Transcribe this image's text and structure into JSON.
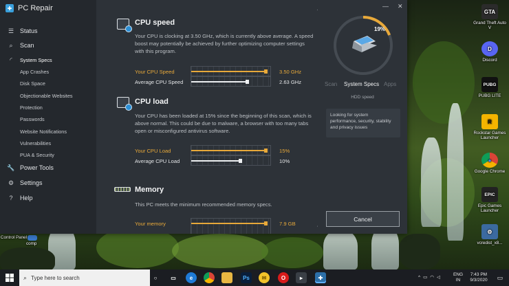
{
  "app": {
    "title": "PC Repair"
  },
  "sidebar": {
    "items": [
      {
        "label": "Status",
        "icon": "list-icon",
        "size": "big"
      },
      {
        "label": "Scan",
        "icon": "search-icon",
        "size": "big"
      },
      {
        "label": "System Specs",
        "icon": "spinner-icon",
        "size": "small",
        "active": true
      },
      {
        "label": "App Crashes",
        "icon": "none",
        "size": "small"
      },
      {
        "label": "Disk Space",
        "icon": "none",
        "size": "small"
      },
      {
        "label": "Objectionable Websites",
        "icon": "none",
        "size": "small"
      },
      {
        "label": "Protection",
        "icon": "none",
        "size": "small"
      },
      {
        "label": "Passwords",
        "icon": "none",
        "size": "small"
      },
      {
        "label": "Website Notifications",
        "icon": "none",
        "size": "small"
      },
      {
        "label": "Vulnerabilities",
        "icon": "none",
        "size": "small"
      },
      {
        "label": "PUA & Security",
        "icon": "none",
        "size": "small"
      },
      {
        "label": "Power Tools",
        "icon": "wrench-icon",
        "size": "big"
      },
      {
        "label": "Settings",
        "icon": "gear-icon",
        "size": "big"
      },
      {
        "label": "Help",
        "icon": "help-icon",
        "size": "big"
      }
    ]
  },
  "sections": {
    "cpu_speed": {
      "title": "CPU speed",
      "description": "Your CPU is clocking at 3.50 GHz, which is currently above average. A speed boost may potentially be achieved by further optimizing computer settings with this program.",
      "rows": [
        {
          "label": "Your CPU Speed",
          "value": "3.50 GHz",
          "fill": 0.95
        },
        {
          "label": "Average CPU Speed",
          "value": "2.63 GHz",
          "fill": 0.71
        }
      ]
    },
    "cpu_load": {
      "title": "CPU load",
      "description": "Your CPU has been loaded at 15% since the beginning of this scan, which is above normal. This could be due to malware, a browser with too many tabs open or misconfigured antivirus software.",
      "rows": [
        {
          "label": "Your CPU Load",
          "value": "15%",
          "fill": 0.95
        },
        {
          "label": "Average CPU Load",
          "value": "10%",
          "fill": 0.63
        }
      ]
    },
    "memory": {
      "title": "Memory",
      "description": "This PC meets the minimum recommended memory specs.",
      "rows": [
        {
          "label": "Your memory",
          "value": "7.9 GB",
          "fill": 0.95
        }
      ]
    }
  },
  "progress": {
    "percent_text": "19%",
    "percent": 0.19
  },
  "carousel": {
    "prev": "Scan",
    "current": "System Specs",
    "next": "Apps"
  },
  "status": {
    "sub": "HDD speed"
  },
  "hint": {
    "text": "Looking for system performance, security, stability and privacy issues"
  },
  "buttons": {
    "cancel": "Cancel"
  },
  "colors": {
    "accent": "#e8a93a",
    "blue": "#2c8fd6",
    "panel": "#2d3238",
    "sidebar": "#24282d"
  },
  "desktop": {
    "icons": [
      {
        "label": "Grand Theft Auto V",
        "short": "GTA"
      },
      {
        "label": "Discord",
        "short": "D"
      },
      {
        "label": "PUBG LITE",
        "short": "PUBG"
      },
      {
        "label": "Rockstar Games Launcher",
        "short": "R"
      },
      {
        "label": "Google Chrome",
        "short": "●"
      },
      {
        "label": "Epic Games Launcher",
        "short": "EPIC"
      },
      {
        "label": "vcredist_x8...",
        "short": "⚙"
      },
      {
        "label": "Control Panel",
        "short": ""
      },
      {
        "label": "comp",
        "short": ""
      }
    ]
  },
  "taskbar": {
    "search_placeholder": "Type here to search",
    "lang": "ENG",
    "region": "IN",
    "time": "7:43 PM",
    "date": "9/3/2020"
  }
}
